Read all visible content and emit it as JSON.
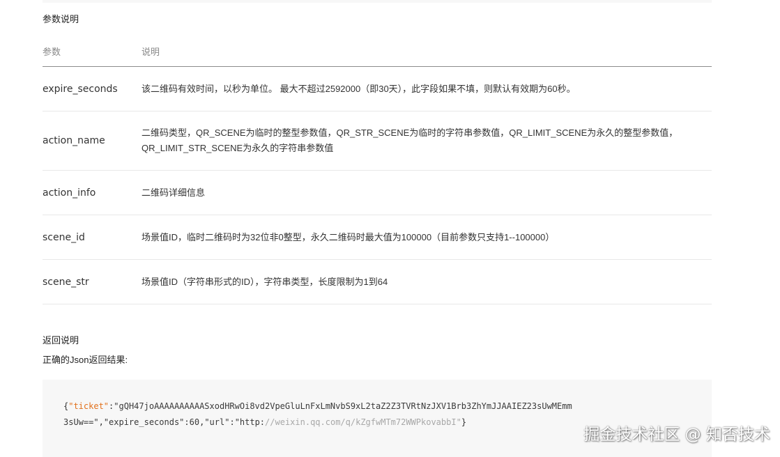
{
  "params_section": {
    "title": "参数说明",
    "headers": {
      "param": "参数",
      "desc": "说明"
    },
    "rows": [
      {
        "name": "expire_seconds",
        "desc": "该二维码有效时间，以秒为单位。 最大不超过2592000（即30天），此字段如果不填，则默认有效期为60秒。"
      },
      {
        "name": "action_name",
        "desc": "二维码类型，QR_SCENE为临时的整型参数值，QR_STR_SCENE为临时的字符串参数值，QR_LIMIT_SCENE为永久的整型参数值，QR_LIMIT_STR_SCENE为永久的字符串参数值"
      },
      {
        "name": "action_info",
        "desc": "二维码详细信息"
      },
      {
        "name": "scene_id",
        "desc": "场景值ID，临时二维码时为32位非0整型，永久二维码时最大值为100000（目前参数只支持1--100000）"
      },
      {
        "name": "scene_str",
        "desc": "场景值ID（字符串形式的ID），字符串类型，长度限制为1到64"
      }
    ]
  },
  "return_section": {
    "title": "返回说明",
    "subtitle": "正确的Json返回结果:"
  },
  "code": {
    "open_brace": "{",
    "k_ticket": "\"ticket\"",
    "colon": ":",
    "v_ticket_1": "\"gQH47joAAAAAAAAAASxodHRwOi8vd2VpeGluLnFxLmNvbS9xL2taZ2Z3TVRtNzJXV1Brb3ZhYmJJAAIEZ23sUwMEmm",
    "v_ticket_2": "3sUw==\"",
    "comma": ",",
    "k_expire": "\"expire_seconds\"",
    "v_expire": "60",
    "k_url": "\"url\"",
    "v_url_prefix": "\"http:",
    "v_url_rest": "//weixin.qq.com/q/kZgfwMTm72WWPkovabbI\"",
    "close_brace": "}"
  },
  "watermark": "掘金技术社区 @ 知否技术",
  "colors": {
    "json_key": "#e2711d",
    "json_comment_url": "#a8a8a8",
    "code_background": "#f7f7f7",
    "header_text": "#888888"
  }
}
